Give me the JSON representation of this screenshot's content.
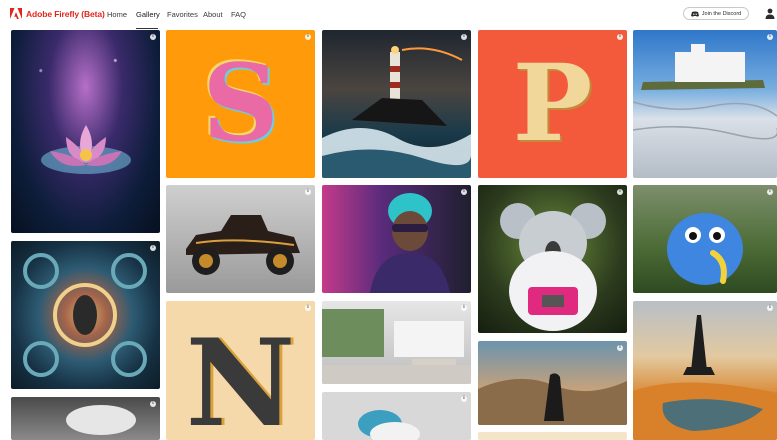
{
  "header": {
    "brand": "Adobe Firefly (Beta)",
    "nav": [
      {
        "label": "Home"
      },
      {
        "label": "Gallery"
      },
      {
        "label": "Favorites"
      },
      {
        "label": "About"
      },
      {
        "label": "FAQ"
      }
    ],
    "discord_button": "Join the Discord",
    "accent_color": "#e1251b"
  },
  "gallery": {
    "info_glyph": "i",
    "items": [
      {
        "subject": "glowing lotus flower in space"
      },
      {
        "subject": "letter S made of yarn"
      },
      {
        "subject": "lighthouse in a stormy sea"
      },
      {
        "subject": "letter P made of popcorn"
      },
      {
        "subject": "white building on a salt flat"
      },
      {
        "subject": "ornate fractal pattern"
      },
      {
        "subject": "vintage car"
      },
      {
        "subject": "man with headphones and neon light"
      },
      {
        "subject": "koala astronaut"
      },
      {
        "subject": "blue fluffy creature with banana"
      },
      {
        "subject": "letter N with dripping paint"
      },
      {
        "subject": "modern interior"
      },
      {
        "subject": "cloaked figure in a canyon"
      },
      {
        "subject": "Eiffel tower in a desert"
      },
      {
        "subject": "clouds in the sky"
      },
      {
        "subject": "blue-haired sculpture"
      }
    ]
  }
}
